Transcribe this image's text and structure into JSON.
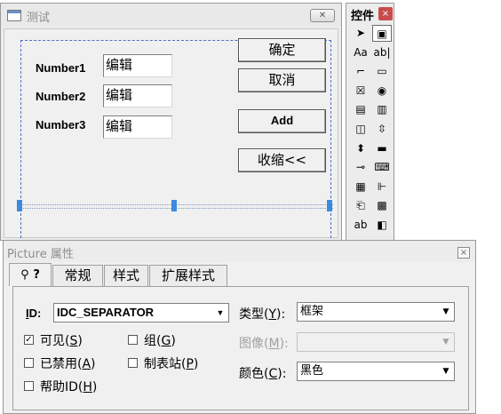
{
  "dialog": {
    "title": "测试",
    "fields": [
      {
        "label": "Number1",
        "value": "编辑"
      },
      {
        "label": "Number2",
        "value": "编辑"
      },
      {
        "label": "Number3",
        "value": "编辑"
      }
    ],
    "buttons": {
      "ok": "确定",
      "cancel": "取消",
      "add": "Add",
      "collapse": "收缩<<"
    }
  },
  "toolbox": {
    "title": "控件",
    "close": "×",
    "tools": [
      {
        "name": "pointer-icon",
        "glyph": "➤"
      },
      {
        "name": "picture-icon",
        "glyph": "▣"
      },
      {
        "name": "static-text-icon",
        "glyph": "Aa"
      },
      {
        "name": "edit-box-icon",
        "glyph": "ab|"
      },
      {
        "name": "group-box-icon",
        "glyph": "⌐"
      },
      {
        "name": "button-icon",
        "glyph": "▭"
      },
      {
        "name": "check-box-icon",
        "glyph": "☒"
      },
      {
        "name": "radio-button-icon",
        "glyph": "◉"
      },
      {
        "name": "combo-box-icon",
        "glyph": "▤"
      },
      {
        "name": "list-box-icon",
        "glyph": "▥"
      },
      {
        "name": "horizontal-scroll-icon",
        "glyph": "◫"
      },
      {
        "name": "vertical-scroll-icon",
        "glyph": "⇳"
      },
      {
        "name": "spin-icon",
        "glyph": "⬍"
      },
      {
        "name": "progress-icon",
        "glyph": "▬"
      },
      {
        "name": "slider-icon",
        "glyph": "⊸"
      },
      {
        "name": "hotkey-icon",
        "glyph": "⌨"
      },
      {
        "name": "list-control-icon",
        "glyph": "▦"
      },
      {
        "name": "tree-control-icon",
        "glyph": "⊩"
      },
      {
        "name": "tab-control-icon",
        "glyph": "⎗"
      },
      {
        "name": "animation-icon",
        "glyph": "▩"
      },
      {
        "name": "rich-edit-icon",
        "glyph": "ab"
      },
      {
        "name": "date-time-icon",
        "glyph": "◧"
      }
    ]
  },
  "properties": {
    "title": "Picture 属性",
    "close": "×",
    "tabs": [
      {
        "label": "常规"
      },
      {
        "label": "样式"
      },
      {
        "label": "扩展样式"
      }
    ],
    "id_label_letter": "I",
    "id_label_rest": "D:",
    "id_value": "IDC_SEPARATOR",
    "type_label": "类型(",
    "type_key": "Y",
    "type_tail": "):",
    "type_value": "框架",
    "image_label": "图像(",
    "image_key": "M",
    "image_tail": "):",
    "color_label": "颜色(",
    "color_key": "C",
    "color_tail": "):",
    "color_value": "黑色",
    "checks": {
      "visible": {
        "text": "可见(",
        "key": "S",
        "tail": ")",
        "checked": true
      },
      "group": {
        "text": "组(",
        "key": "G",
        "tail": ")",
        "checked": false
      },
      "disabled": {
        "text": "已禁用(",
        "key": "A",
        "tail": ")",
        "checked": false
      },
      "tabstop": {
        "text": "制表站(",
        "key": "P",
        "tail": ")",
        "checked": false
      },
      "helpid": {
        "text": "帮助ID(",
        "key": "H",
        "tail": ")",
        "checked": false
      }
    }
  }
}
